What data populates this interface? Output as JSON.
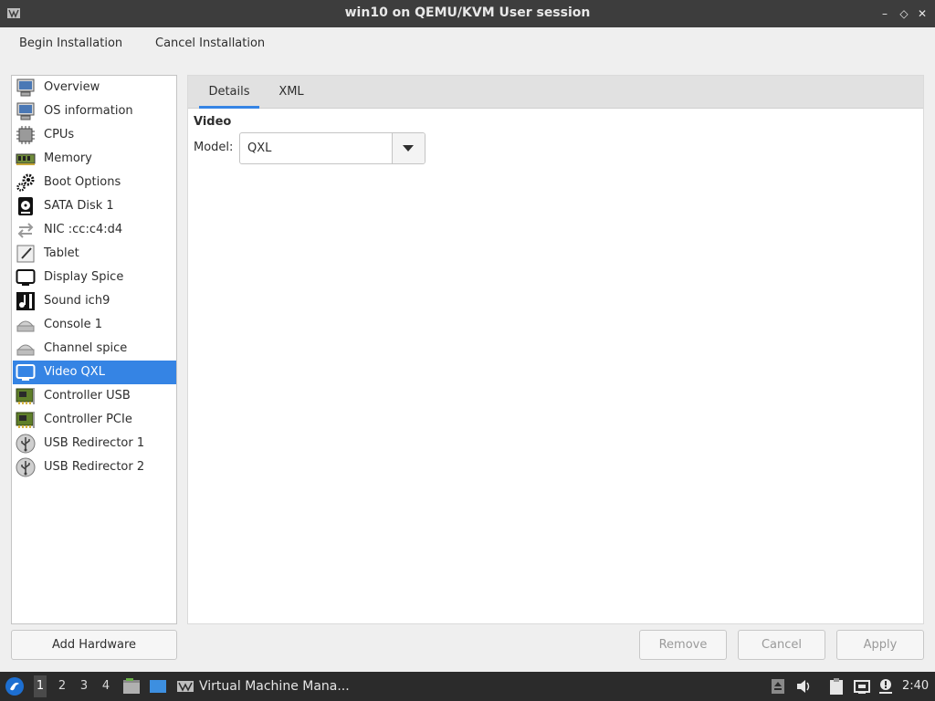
{
  "window": {
    "title": "win10 on QEMU/KVM User session",
    "controls": {
      "minimize": "–",
      "maximize": "◇",
      "close": "✕"
    }
  },
  "toolbar": {
    "begin_label": "Begin Installation",
    "cancel_label": "Cancel Installation"
  },
  "sidebar": {
    "items": [
      {
        "label": "Overview",
        "icon": "monitor-info-icon"
      },
      {
        "label": "OS information",
        "icon": "monitor-info-icon"
      },
      {
        "label": "CPUs",
        "icon": "cpu-chip-icon"
      },
      {
        "label": "Memory",
        "icon": "memory-module-icon"
      },
      {
        "label": "Boot Options",
        "icon": "gears-icon"
      },
      {
        "label": "SATA Disk 1",
        "icon": "hard-disk-icon"
      },
      {
        "label": "NIC :cc:c4:d4",
        "icon": "network-arrows-icon"
      },
      {
        "label": "Tablet",
        "icon": "tablet-pen-icon"
      },
      {
        "label": "Display Spice",
        "icon": "display-icon"
      },
      {
        "label": "Sound ich9",
        "icon": "sound-card-icon"
      },
      {
        "label": "Console 1",
        "icon": "serial-port-icon"
      },
      {
        "label": "Channel spice",
        "icon": "serial-port-icon"
      },
      {
        "label": "Video QXL",
        "icon": "video-display-icon",
        "selected": true
      },
      {
        "label": "Controller USB",
        "icon": "pci-card-icon"
      },
      {
        "label": "Controller PCIe",
        "icon": "pci-card-icon"
      },
      {
        "label": "USB Redirector 1",
        "icon": "usb-icon"
      },
      {
        "label": "USB Redirector 2",
        "icon": "usb-icon"
      }
    ],
    "add_hardware_label": "Add Hardware"
  },
  "main": {
    "tabs": [
      {
        "label": "Details",
        "active": true
      },
      {
        "label": "XML",
        "active": false
      }
    ],
    "section_title": "Video",
    "model_label": "Model:",
    "model_value": "QXL"
  },
  "footer": {
    "remove_label": "Remove",
    "cancel_label": "Cancel",
    "apply_label": "Apply"
  },
  "taskbar": {
    "workspaces": [
      "1",
      "2",
      "3",
      "4"
    ],
    "active_workspace": "1",
    "task_label": "Virtual Machine Mana...",
    "clock": "2:40"
  },
  "colors": {
    "accent": "#3584e4",
    "titlebar": "#3d3d3d",
    "taskbar": "#2b2b2b"
  }
}
